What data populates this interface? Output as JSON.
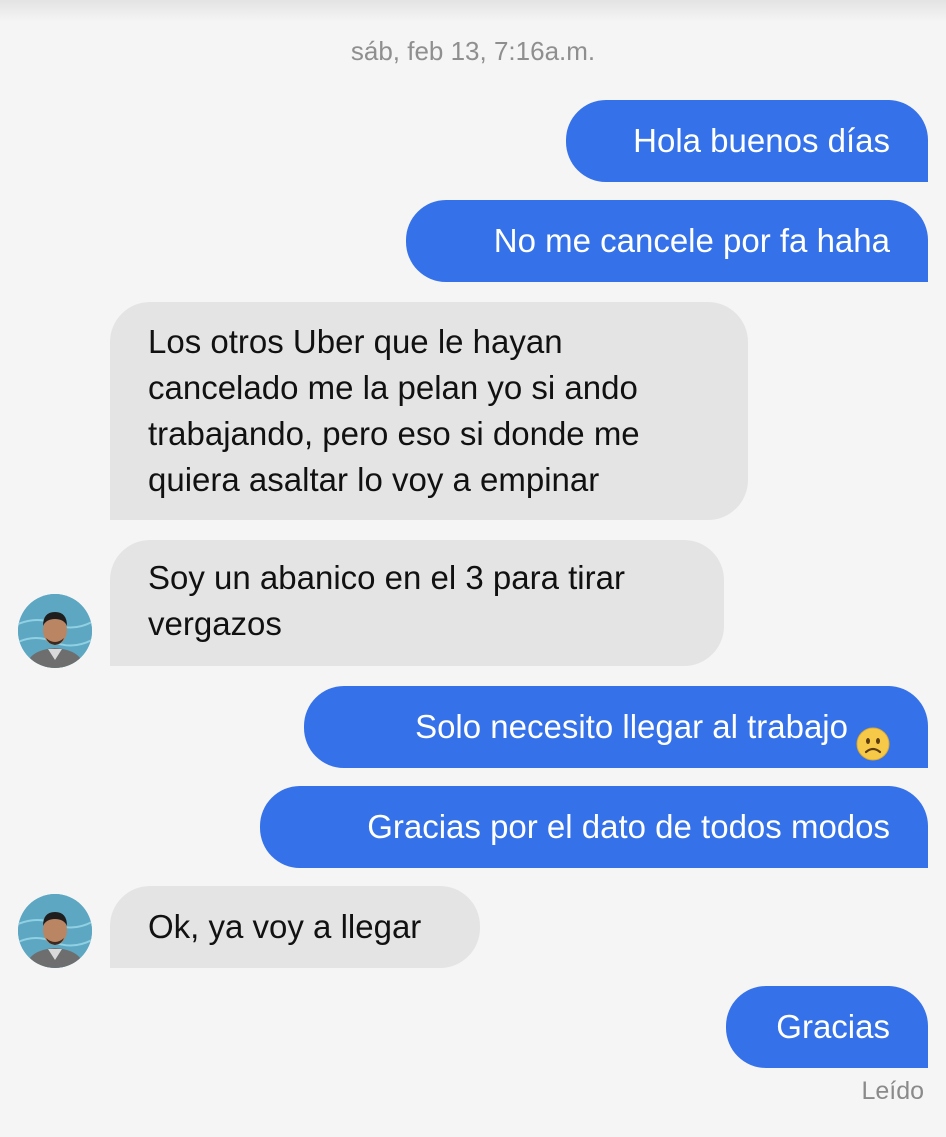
{
  "conversation": {
    "timestamp": "sáb, feb 13, 7:16a.m.",
    "messages": [
      {
        "direction": "outgoing",
        "text": "Hola buenos días"
      },
      {
        "direction": "outgoing",
        "text": "No me cancele por fa haha"
      },
      {
        "direction": "incoming",
        "lines": [
          "Los otros Uber que le hayan",
          "cancelado me la pelan yo si ando",
          "trabajando, pero eso si donde me",
          "quiera asaltar lo voy a empinar"
        ]
      },
      {
        "direction": "incoming",
        "lines": [
          "Soy un abanico en el 3 para tirar",
          "vergazos"
        ],
        "avatar": "driver-avatar"
      },
      {
        "direction": "outgoing",
        "text": "Solo necesito llegar al trabajo",
        "emoji": "frowning-face-emoji"
      },
      {
        "direction": "outgoing",
        "text": "Gracias por el dato de todos modos"
      },
      {
        "direction": "incoming",
        "text": "Ok, ya voy a llegar",
        "avatar": "driver-avatar"
      },
      {
        "direction": "outgoing",
        "text": "Gracias"
      }
    ],
    "read_status": "Leído"
  },
  "colors": {
    "background": "#f5f5f5",
    "outgoing_bubble": "#3571e8",
    "incoming_bubble": "#e4e4e4",
    "timestamp_text": "#8f8f8f",
    "avatar_background": "#5ea7c2"
  }
}
